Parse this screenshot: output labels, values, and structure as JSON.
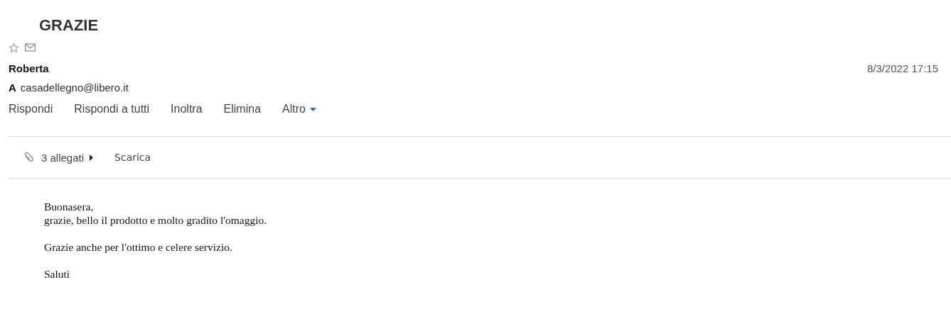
{
  "subject": "GRAZIE",
  "sender": "Roberta",
  "date": "8/3/2022 17:15",
  "to_label": "A",
  "to": "casadellegno@libero.it",
  "actions": [
    {
      "label": "Rispondi",
      "kind": "plain"
    },
    {
      "label": "Rispondi a tutti",
      "kind": "plain"
    },
    {
      "label": "Inoltra",
      "kind": "plain"
    },
    {
      "label": "Elimina",
      "kind": "plain"
    },
    {
      "label": "Altro",
      "kind": "menu"
    }
  ],
  "attachments": {
    "count": "3 allegati",
    "download": "Scarica"
  },
  "body": [
    "Buonasera,\ngrazie, bello il prodotto e molto gradito l'omaggio.",
    "Grazie anche per l'ottimo e celere servizio.",
    "Saluti"
  ]
}
